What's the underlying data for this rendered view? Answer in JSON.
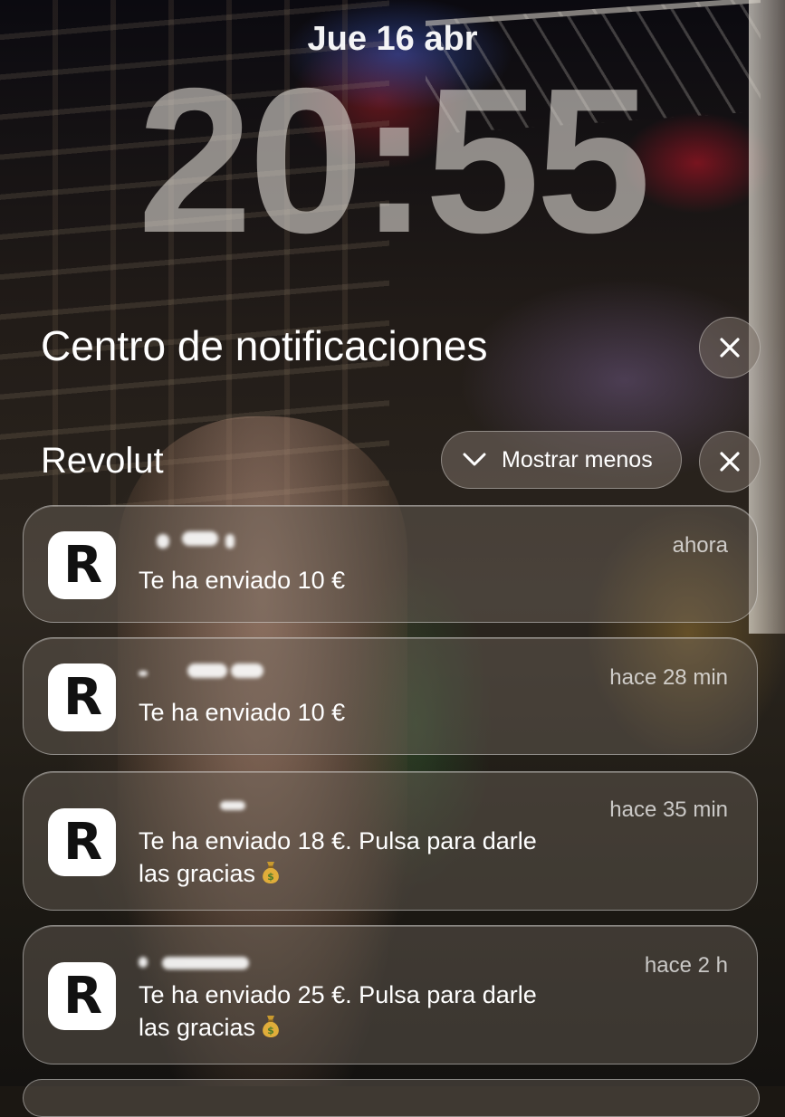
{
  "lock_screen": {
    "date": "Jue 16 abr",
    "time": "20:55"
  },
  "notification_center": {
    "title": "Centro de notificaciones",
    "close_icon": "close-icon"
  },
  "group": {
    "app_name": "Revolut",
    "show_less_label": "Mostrar menos",
    "show_less_icon": "chevron-down-icon",
    "close_icon": "close-icon"
  },
  "notifications": [
    {
      "app_icon": "revolut-r-icon",
      "icon_letter": "R",
      "time": "ahora",
      "message": "Te ha enviado 10 €"
    },
    {
      "app_icon": "revolut-r-icon",
      "icon_letter": "R",
      "time": "hace 28 min",
      "message": "Te ha enviado 10 €"
    },
    {
      "app_icon": "revolut-r-icon",
      "icon_letter": "R",
      "time": "hace 35 min",
      "message_line1": "Te ha enviado 18 €. Pulsa para darle",
      "message_line2": "las gracias",
      "emoji": "money-bag-icon"
    },
    {
      "app_icon": "revolut-r-icon",
      "icon_letter": "R",
      "time": "hace 2 h",
      "message_line1": "Te ha enviado 25 €. Pulsa para darle",
      "message_line2": "las gracias",
      "emoji": "money-bag-icon"
    }
  ]
}
